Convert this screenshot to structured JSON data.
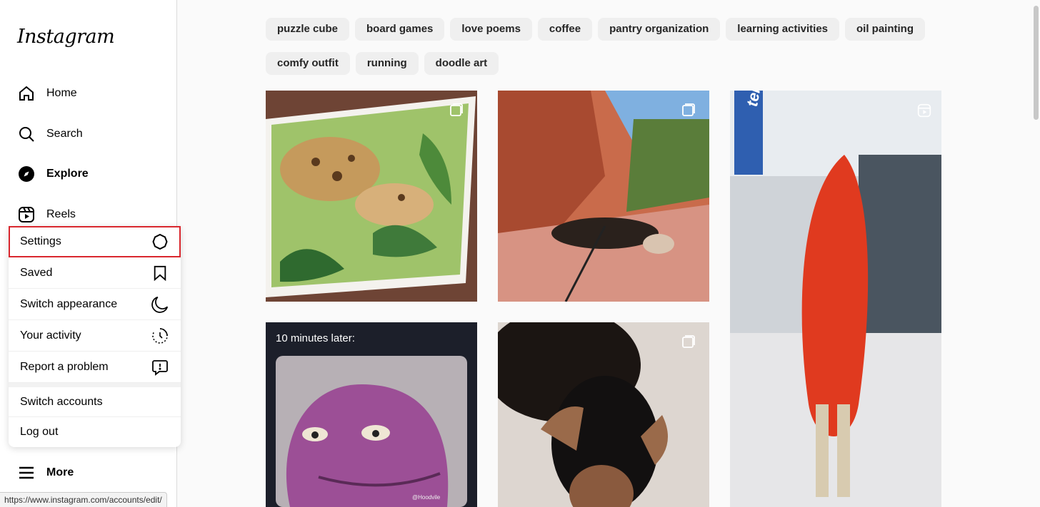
{
  "brand": {
    "logo_text": "Instagram"
  },
  "nav": {
    "home": "Home",
    "search": "Search",
    "explore": "Explore",
    "reels": "Reels",
    "more": "More"
  },
  "menu": {
    "items": [
      {
        "label": "Settings",
        "icon": "gear-icon"
      },
      {
        "label": "Saved",
        "icon": "bookmark-icon"
      },
      {
        "label": "Switch appearance",
        "icon": "moon-icon"
      },
      {
        "label": "Your activity",
        "icon": "activity-icon"
      },
      {
        "label": "Report a problem",
        "icon": "report-icon"
      }
    ],
    "switch_accounts": "Switch accounts",
    "log_out": "Log out"
  },
  "chips": [
    "puzzle cube",
    "board games",
    "love poems",
    "coffee",
    "pantry organization",
    "learning activities",
    "oil painting",
    "comfy outfit",
    "running",
    "doodle art"
  ],
  "posts": {
    "meme_caption": "10 minutes later:",
    "meme_watermark": "@Hoodvile",
    "mall_sign": "telcel"
  },
  "status_url": "https://www.instagram.com/accounts/edit/",
  "colors": {
    "highlight": "#d9272e",
    "background": "#fafafa"
  }
}
